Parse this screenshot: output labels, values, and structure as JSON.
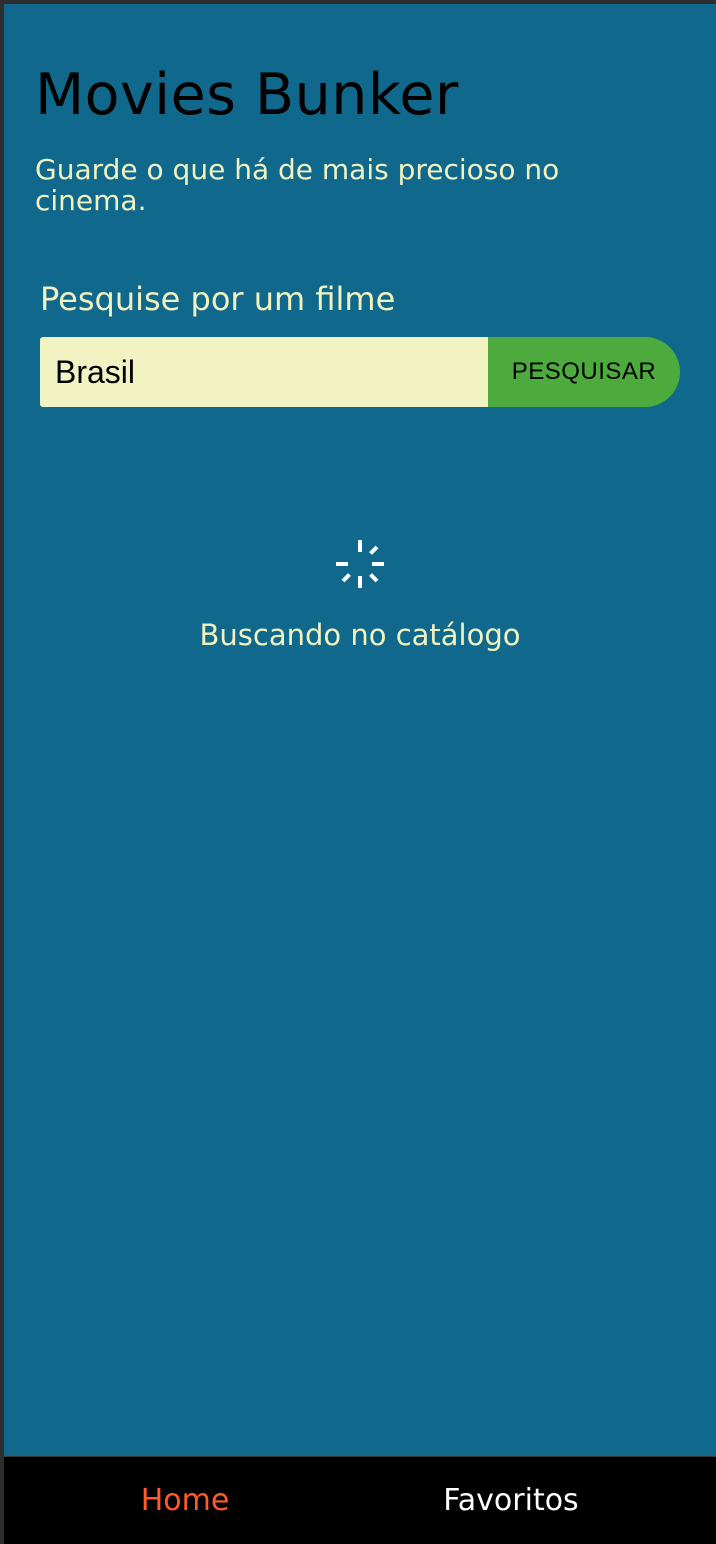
{
  "header": {
    "title": "Movies Bunker",
    "subtitle": "Guarde o que há de mais precioso no cinema."
  },
  "search": {
    "label": "Pesquise por um filme",
    "value": "Brasil",
    "button_label": "PESQUISAR"
  },
  "loading": {
    "icon": "spinner-icon",
    "text": "Buscando no catálogo"
  },
  "nav": {
    "items": [
      {
        "label": "Home",
        "active": true
      },
      {
        "label": "Favoritos",
        "active": false
      }
    ]
  },
  "colors": {
    "background": "#10698d",
    "accent_text": "#f0f3c0",
    "button": "#4cab3c",
    "nav_active": "#ff5a2a"
  }
}
